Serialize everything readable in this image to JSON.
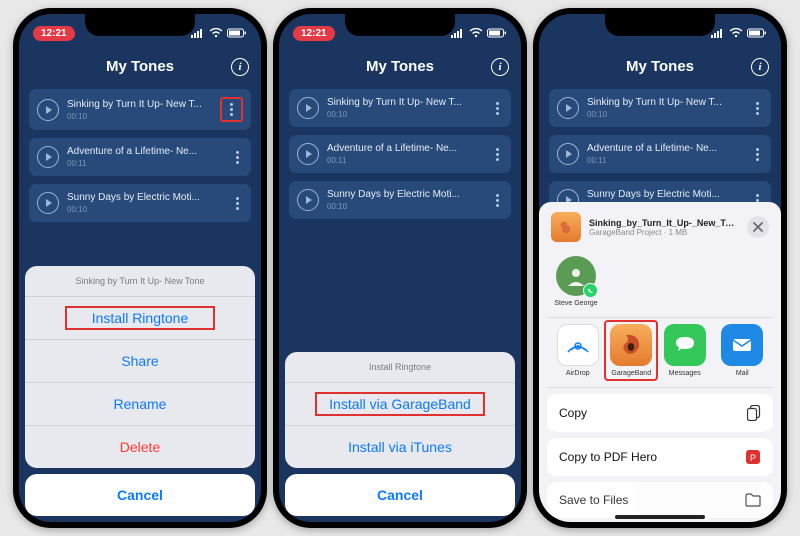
{
  "status_time": "12:21",
  "header_title": "My Tones",
  "tones": [
    {
      "title": "Sinking by Turn It Up- New T...",
      "duration": "00:10"
    },
    {
      "title": "Adventure of a Lifetime- Ne...",
      "duration": "00:11"
    },
    {
      "title": "Sunny Days by Electric Moti...",
      "duration": "00:10"
    }
  ],
  "sheet1": {
    "title": "Sinking by Turn It Up- New Tone",
    "install": "Install Ringtone",
    "share": "Share",
    "rename": "Rename",
    "delete": "Delete",
    "cancel": "Cancel"
  },
  "sheet2": {
    "title": "Install Ringtone",
    "garageband": "Install via GarageBand",
    "itunes": "Install via iTunes",
    "cancel": "Cancel"
  },
  "share": {
    "file_name": "Sinking_by_Turn_It_Up-_New_Tone",
    "file_sub": "GarageBand Project · 1 MB",
    "contact": "Steve George",
    "apps": {
      "airdrop": "AirDrop",
      "garageband": "GarageBand",
      "messages": "Messages",
      "mail": "Mail"
    },
    "actions": {
      "copy": "Copy",
      "copy_pdf": "Copy to PDF Hero",
      "save_files": "Save to Files"
    }
  }
}
